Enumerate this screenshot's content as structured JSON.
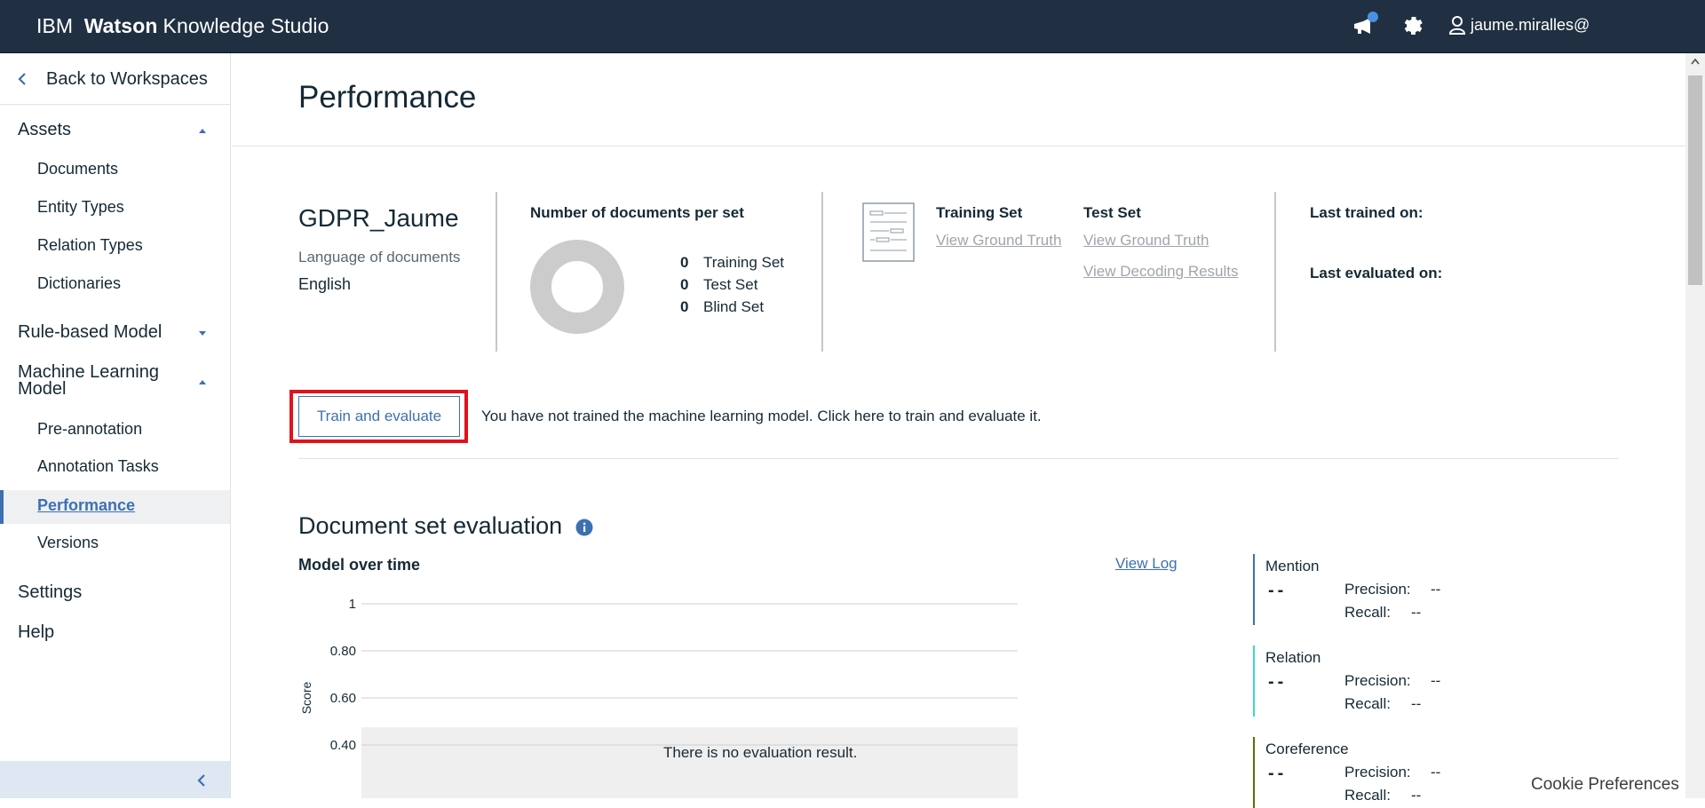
{
  "app": {
    "brand_ibm": "IBM",
    "brand_watson": "Watson",
    "brand_rest": "Knowledge Studio",
    "user": "jaume.miralles@"
  },
  "sidebar": {
    "back": "Back to Workspaces",
    "sections": {
      "assets": "Assets",
      "rule_based": "Rule-based Model",
      "ml_model_line1": "Machine Learning",
      "ml_model_line2": "Model",
      "settings": "Settings",
      "help": "Help"
    },
    "assets_items": [
      "Documents",
      "Entity Types",
      "Relation Types",
      "Dictionaries"
    ],
    "ml_items": [
      "Pre-annotation",
      "Annotation Tasks",
      "Performance",
      "Versions"
    ]
  },
  "page": {
    "title": "Performance",
    "workspace_name": "GDPR_Jaume",
    "language_label": "Language of documents",
    "language_value": "English",
    "docs_heading": "Number of documents per set",
    "sets": [
      {
        "count": "0",
        "label": "Training Set"
      },
      {
        "count": "0",
        "label": "Test Set"
      },
      {
        "count": "0",
        "label": "Blind Set"
      }
    ],
    "training_set_title": "Training Set",
    "test_set_title": "Test Set",
    "view_ground_truth": "View Ground Truth",
    "view_decoding_results": "View Decoding Results",
    "last_trained": "Last trained on:",
    "last_evaluated": "Last evaluated on:",
    "train_button": "Train and evaluate",
    "train_message": "You have not trained the machine learning model. Click here to train and evaluate it.",
    "eval_title": "Document set evaluation",
    "model_over_time": "Model over time",
    "view_log": "View Log",
    "no_result": "There is no evaluation result.",
    "cookie": "Cookie Preferences"
  },
  "chart_data": {
    "type": "line",
    "title": "",
    "xlabel": "",
    "ylabel": "Score",
    "yticks": [
      "1",
      "0.80",
      "0.60",
      "0.40"
    ],
    "series": [],
    "grid": true
  },
  "metrics": [
    {
      "name": "Mention",
      "value": "--",
      "precision_label": "Precision:",
      "precision": "--",
      "recall_label": "Recall:",
      "recall": "--",
      "color": "#3d70b2"
    },
    {
      "name": "Relation",
      "value": "--",
      "precision_label": "Precision:",
      "precision": "--",
      "recall_label": "Recall:",
      "recall": "--",
      "color": "#41d6c3"
    },
    {
      "name": "Coreference",
      "value": "--",
      "precision_label": "Precision:",
      "precision": "--",
      "recall_label": "Recall:",
      "recall": "--",
      "color": "#5a6f00"
    }
  ],
  "colors": {
    "topbar": "#203042",
    "accent": "#3d70b2",
    "highlight": "#e3111b",
    "donut": "#cccccc"
  }
}
